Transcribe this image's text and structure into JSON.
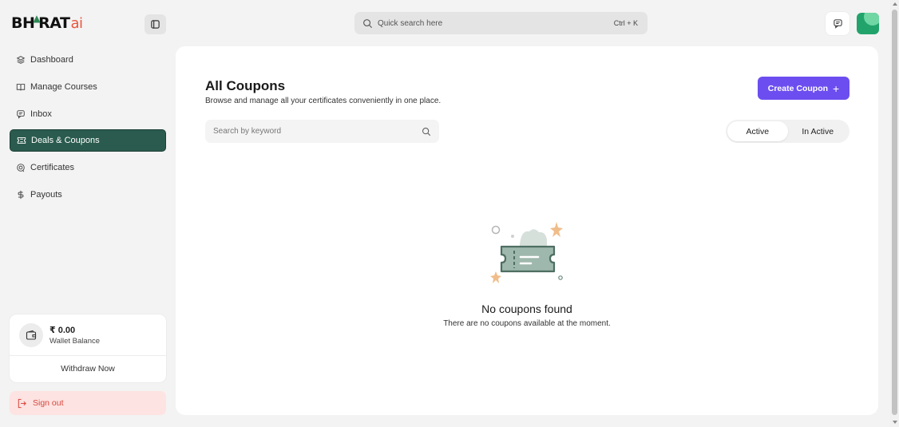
{
  "brand": {
    "name_main": "BH",
    "name_mid": "RAT",
    "name_suffix": "ai"
  },
  "sidebar": {
    "items": [
      {
        "label": "Dashboard",
        "icon": "layers-icon",
        "active": false
      },
      {
        "label": "Manage Courses",
        "icon": "book-icon",
        "active": false
      },
      {
        "label": "Inbox",
        "icon": "chat-icon",
        "active": false
      },
      {
        "label": "Deals & Coupons",
        "icon": "ticket-icon",
        "active": true
      },
      {
        "label": "Certificates",
        "icon": "award-icon",
        "active": false
      },
      {
        "label": "Payouts",
        "icon": "dollar-icon",
        "active": false
      }
    ],
    "wallet": {
      "amount": "₹ 0.00",
      "label": "Wallet Balance",
      "withdraw_label": "Withdraw Now"
    },
    "signout_label": "Sign out"
  },
  "topbar": {
    "search_placeholder": "Quick search here",
    "shortcut": "Ctrl + K"
  },
  "main": {
    "title": "All Coupons",
    "subtitle": "Browse and manage all your certificates conveniently in one place.",
    "create_button": "Create Coupon",
    "keyword_placeholder": "Search by keyword",
    "tabs": [
      {
        "label": "Active",
        "selected": true
      },
      {
        "label": "In Active",
        "selected": false
      }
    ],
    "empty": {
      "title": "No coupons found",
      "message": "There are no coupons available at the moment."
    }
  },
  "colors": {
    "accent": "#6c4ef0",
    "nav_active": "#2a5b4e",
    "signout_bg": "#fde3e1",
    "signout_text": "#d9473f"
  }
}
